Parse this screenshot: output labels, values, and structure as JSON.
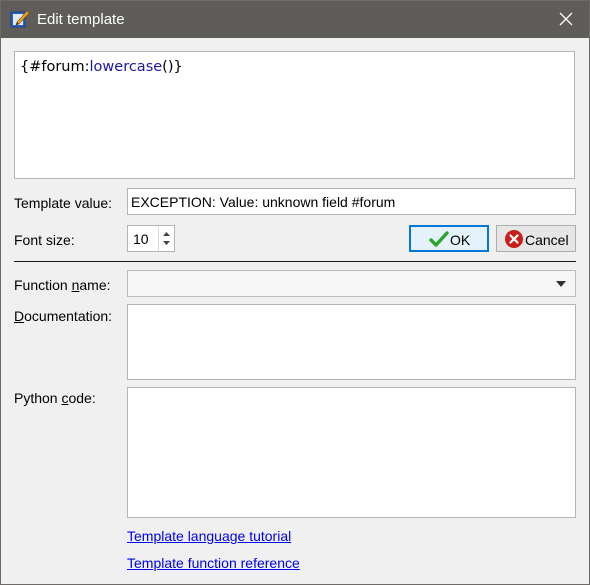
{
  "window": {
    "title": "Edit template"
  },
  "editor": {
    "open": "{#forum:",
    "fn": "lowercase",
    "close": "()}"
  },
  "template_value": {
    "label": "Template value:",
    "value": "EXCEPTION:  Value: unknown field #forum"
  },
  "font_size": {
    "label": "Font size:",
    "value": "10"
  },
  "buttons": {
    "ok": "OK",
    "cancel": "Cancel"
  },
  "function_name": {
    "label_pre": "Function ",
    "label_u": "n",
    "label_post": "ame:",
    "value": ""
  },
  "documentation": {
    "label_u": "D",
    "label_post": "ocumentation:"
  },
  "python_code": {
    "label_pre": "Python ",
    "label_u": "c",
    "label_post": "ode:"
  },
  "links": {
    "tutorial": "Template language tutorial",
    "reference": "Template function reference"
  },
  "colors": {
    "titlebar": "#5f5d5a",
    "function_text": "#1919a6",
    "link": "#0000ee",
    "ok_check": "#2aa52a",
    "cancel_icon": "#c81e1e"
  },
  "icons": {
    "title": "edit-template-pencil-icon",
    "close": "close-icon",
    "ok": "checkmark-icon",
    "cancel": "cancel-icon",
    "combo": "chevron-down-icon"
  }
}
